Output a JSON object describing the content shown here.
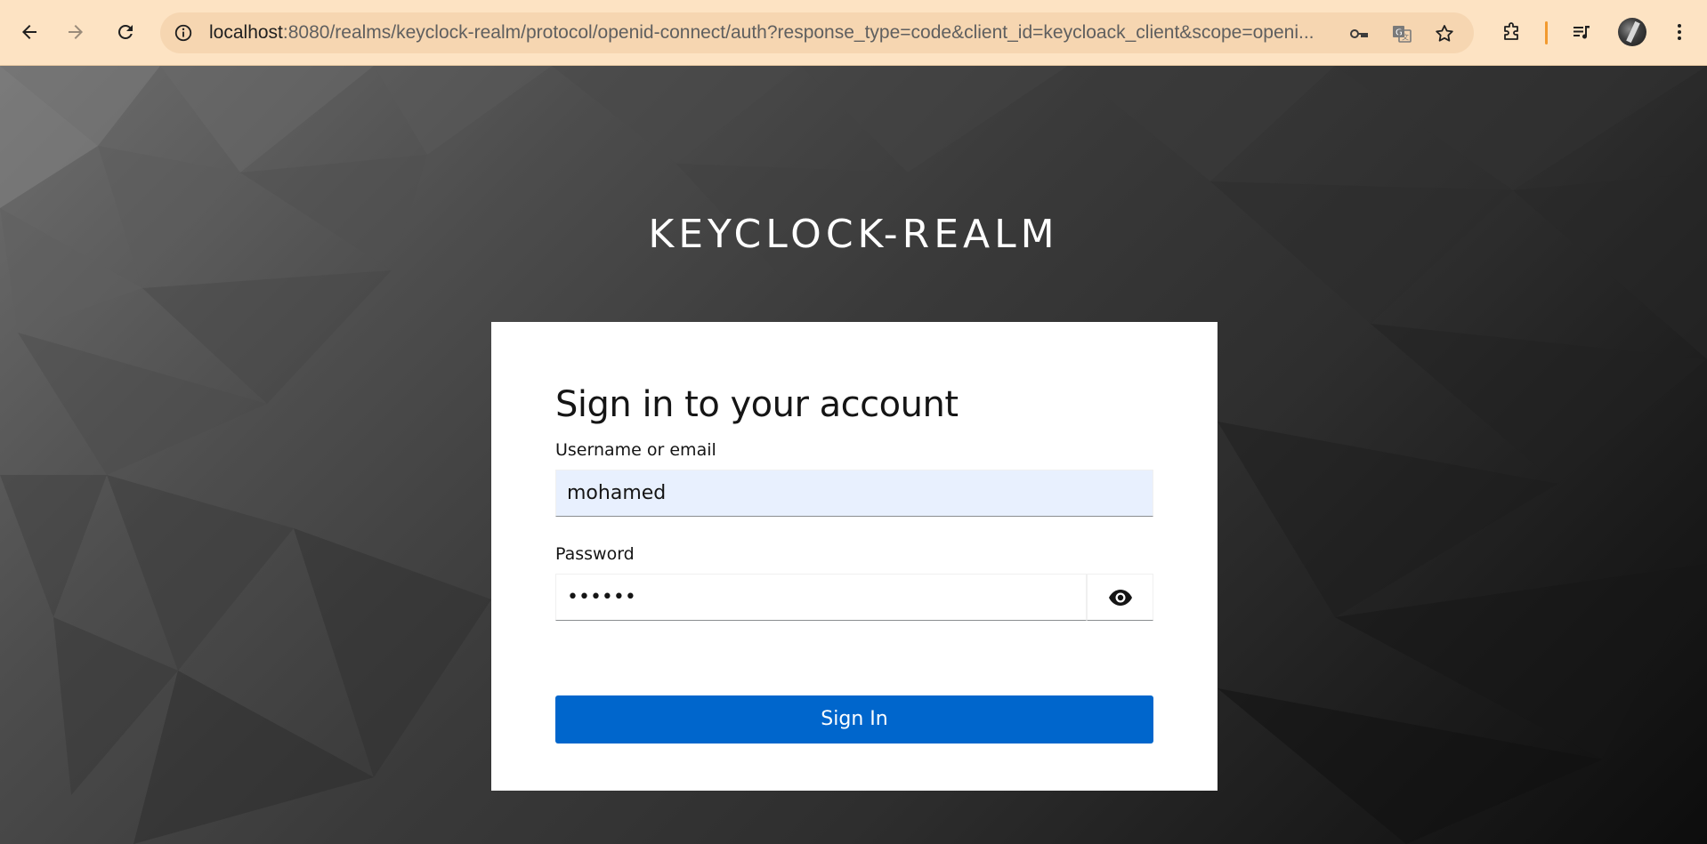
{
  "browser": {
    "url_host": "localhost",
    "url_path": ":8080/realms/keyclock-realm/protocol/openid-connect/auth?response_type=code&client_id=keycloack_client&scope=openi...",
    "icons": [
      "back-icon",
      "forward-icon",
      "reload-icon",
      "site-info-icon",
      "password-key-icon",
      "translate-icon",
      "bookmark-star-icon",
      "extensions-icon",
      "media-control-icon",
      "profile-avatar",
      "more-menu-icon"
    ],
    "accent_color": "#f29a2e"
  },
  "page": {
    "realm_title": "KEYCLOCK-REALM",
    "heading": "Sign in to your account",
    "username_label": "Username or email",
    "username_value": "mohamed",
    "password_label": "Password",
    "password_value": "••••••",
    "signin_label": "Sign In",
    "button_color": "#0066cc"
  }
}
